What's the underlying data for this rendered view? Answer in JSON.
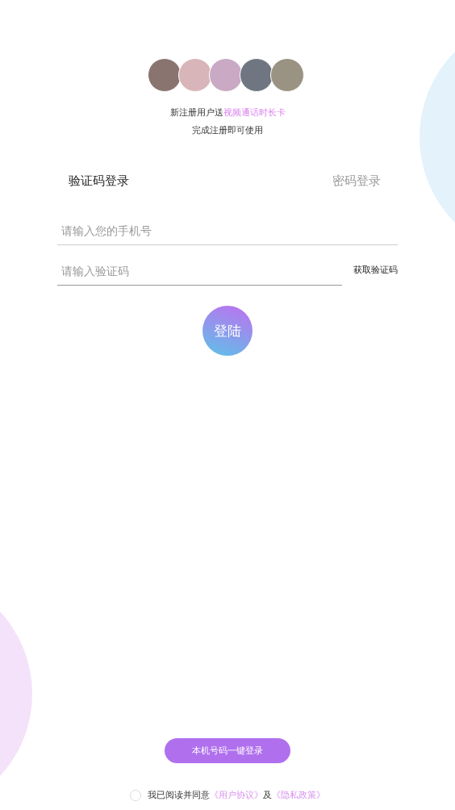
{
  "avatars": [
    {
      "kind": "photo"
    },
    {
      "kind": "photo"
    },
    {
      "kind": "photo"
    },
    {
      "kind": "photo"
    },
    {
      "kind": "photo"
    }
  ],
  "promo": {
    "text": "新注册用户送",
    "highlight": "视频通话时长卡"
  },
  "promo_note": "完成注册即可使用",
  "tabs": [
    {
      "label": "验证码登录",
      "selected": true
    },
    {
      "label": "密码登录",
      "selected": false
    }
  ],
  "phone_field": {
    "placeholder": "请输入您的手机号"
  },
  "code_field": {
    "placeholder": "请输入验证码"
  },
  "get_code_button": "获取验证码",
  "login_button": "登陆",
  "one_tap_button": "本机号码一键登录",
  "agreement": {
    "checked": false,
    "text": "我已阅读并同意",
    "link_1": "《用户协议》",
    "joiner": "及",
    "link_2": "《隐私政策》"
  }
}
